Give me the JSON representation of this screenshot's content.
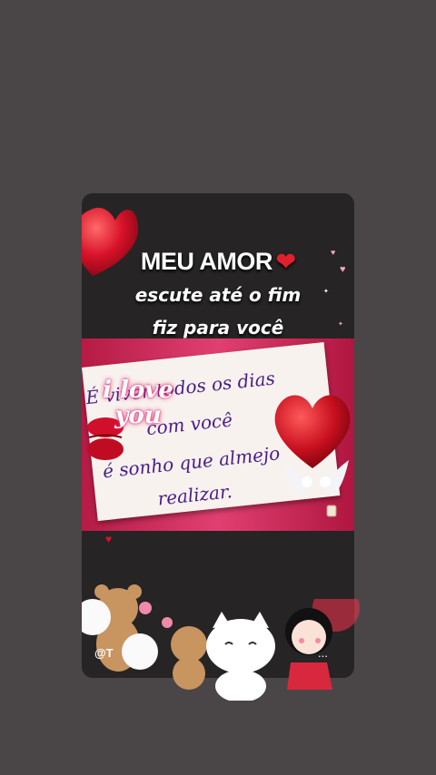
{
  "title": "MEU AMOR",
  "title_emoji": "❤️",
  "subtitle_1": "escute até o fim",
  "subtitle_2": "fiz para você",
  "banner_lines": [
    "É viver todos os dias",
    "com você",
    "é sonho que almejo",
    "realizar."
  ],
  "sticker_text": "i love you",
  "watermark": "@T",
  "watermark_more": "...",
  "colors": {
    "background": "#4a4648",
    "card": "#262425",
    "banner": "#d23461",
    "heart": "#d8132a",
    "text_banner": "#4a1c8a"
  }
}
